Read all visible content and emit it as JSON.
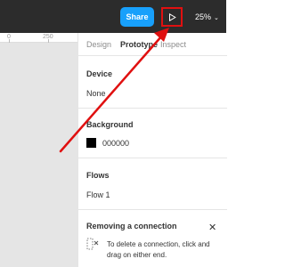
{
  "toolbar": {
    "share_label": "Share",
    "play_icon": "play-icon",
    "zoom_level": "25%",
    "zoom_chevron_icon": "chevron-down-icon"
  },
  "ruler": {
    "ticks": [
      "0",
      "250"
    ]
  },
  "panel": {
    "tabs": {
      "design": "Design",
      "prototype": "Prototype",
      "inspect": "Inspect"
    },
    "device": {
      "title": "Device",
      "value": "None"
    },
    "background": {
      "title": "Background",
      "hex": "000000",
      "color": "#000000"
    },
    "flows": {
      "title": "Flows",
      "item": "Flow 1"
    },
    "hint": {
      "title": "Removing a connection",
      "text": "To delete a connection, click and drag on either end."
    }
  },
  "colors": {
    "accent": "#18a0fb",
    "annotation": "#e01010",
    "toolbar_bg": "#2c2c2c"
  }
}
